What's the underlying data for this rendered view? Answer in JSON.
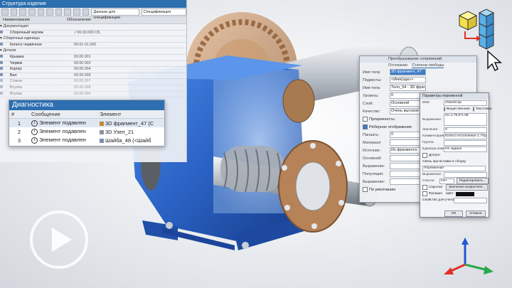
{
  "structure": {
    "title": "Структура изделия",
    "view_combo": "Данные для спецификации",
    "spec_combo": "Спецификация",
    "columns": [
      "Наименование",
      "Обозначение"
    ],
    "rows": [
      {
        "name": "Документация",
        "designation": "",
        "group": true
      },
      {
        "name": "Сборочный чертеж",
        "designation": "√ 00.00.000 СБ",
        "group": false
      },
      {
        "name": "Сборочные единицы",
        "designation": "",
        "group": true
      },
      {
        "name": "Колесо червячное",
        "designation": "00.01-01.000",
        "group": false
      },
      {
        "name": "Детали",
        "designation": "",
        "group": true
      },
      {
        "name": "Крышка",
        "designation": "00.00.001",
        "group": false
      },
      {
        "name": "Червяк",
        "designation": "00.00.002",
        "group": false
      },
      {
        "name": "Корпус",
        "designation": "00.00.004",
        "group": false
      },
      {
        "name": "Вал",
        "designation": "00.00.005",
        "group": false
      },
      {
        "name": "Стакан",
        "designation": "00.00.007",
        "group": false
      },
      {
        "name": "Втулка",
        "designation": "00.00.008",
        "group": false
      },
      {
        "name": "Втулка",
        "designation": "00.00.009",
        "group": false
      }
    ]
  },
  "diagnostics": {
    "title": "Диагностика",
    "columns": [
      "#",
      "Сообщение",
      "Элемент"
    ],
    "rows": [
      {
        "num": "1",
        "message": "Элемент подавлен",
        "element": "3D фрагмент_47 (С"
      },
      {
        "num": "2",
        "message": "Элемент подавлен",
        "element": "3D Узел_21"
      },
      {
        "num": "3",
        "message": "Элемент подавлен",
        "element": "Шайба_48 (<Шайб"
      }
    ]
  },
  "panel1": {
    "title": "Преобразование сопряжений",
    "tabs": [
      "Отсекание",
      "Степени свободы"
    ],
    "fields": [
      {
        "label": "Имя тела:",
        "value": "3D фрагмент_47",
        "selected": true
      },
      {
        "label": "Подвесты:",
        "value": "<Имя(ода>>",
        "selected": false
      },
      {
        "label": "Имя тела:",
        "value": "Тело_64 - 3D фрагм",
        "selected": false
      },
      {
        "label": "Уровень:",
        "value": "0",
        "selected": false
      },
      {
        "label": "Слой:",
        "value": "Основной",
        "selected": false
      },
      {
        "label": "Качество:",
        "value": "Очень высокое",
        "selected": false
      }
    ],
    "checks": [
      "Прозрачность:",
      "Рёберное отображение"
    ],
    "more_fields": [
      {
        "label": "Пагшать:",
        "value": "0"
      },
      {
        "label": "Материал",
        "value": ""
      },
      {
        "label": "Источник:",
        "value": "Из фрагмента"
      },
      {
        "label": "Основной:",
        "value": ""
      },
      {
        "label": "Выражение:",
        "value": ""
      },
      {
        "label": "Популяция:",
        "value": ""
      },
      {
        "label": "Выражение:",
        "value": ""
      }
    ],
    "footer_check": "По умолчанию"
  },
  "panel2": {
    "title": "Параметры переменной",
    "fields": [
      {
        "label": "Имя:",
        "value": "vNewScop"
      },
      {
        "label": "Выражение:",
        "value": "ex=1.79.9*1.0Е"
      },
      {
        "label": "Значение:",
        "value": "0"
      },
      {
        "label": "Комментарий:",
        "value": "Колесо исполнение 1. Подавить"
      },
      {
        "label": "Группа:",
        "value": ""
      },
      {
        "label": "Единица измерения:",
        "value": "Не задана"
      }
    ],
    "radio_labels": [
      "Вещественная",
      "Текстовая"
    ],
    "interval_label": "Допуск:",
    "section_label": "Связь при вставке в сборку",
    "link_value": "Переменная",
    "expression_label": "Выражение:",
    "source_label": "Список:",
    "source_value": "Нет",
    "edit_button": "Редактировать...",
    "hidden_check": "Скрытая",
    "default_button": "Значения конкретнее...",
    "function_label": "Функция",
    "color_label": "Цвет:",
    "accuracy_label": "Свойство для учета:",
    "ok_button": "ОК",
    "cancel_button": "Отмена"
  },
  "colors": {
    "accent_blue": "#2d6fb0",
    "machine_blue": "#2a66c9",
    "bronze": "#b8845a",
    "cube_yellow": "#f4e04a",
    "cube_blue": "#5ab0e8",
    "arrow_red": "#e0302a"
  },
  "icons": [
    "info-icon",
    "play-icon",
    "cursor-icon",
    "axis-triad-icon",
    "cube-icon"
  ]
}
